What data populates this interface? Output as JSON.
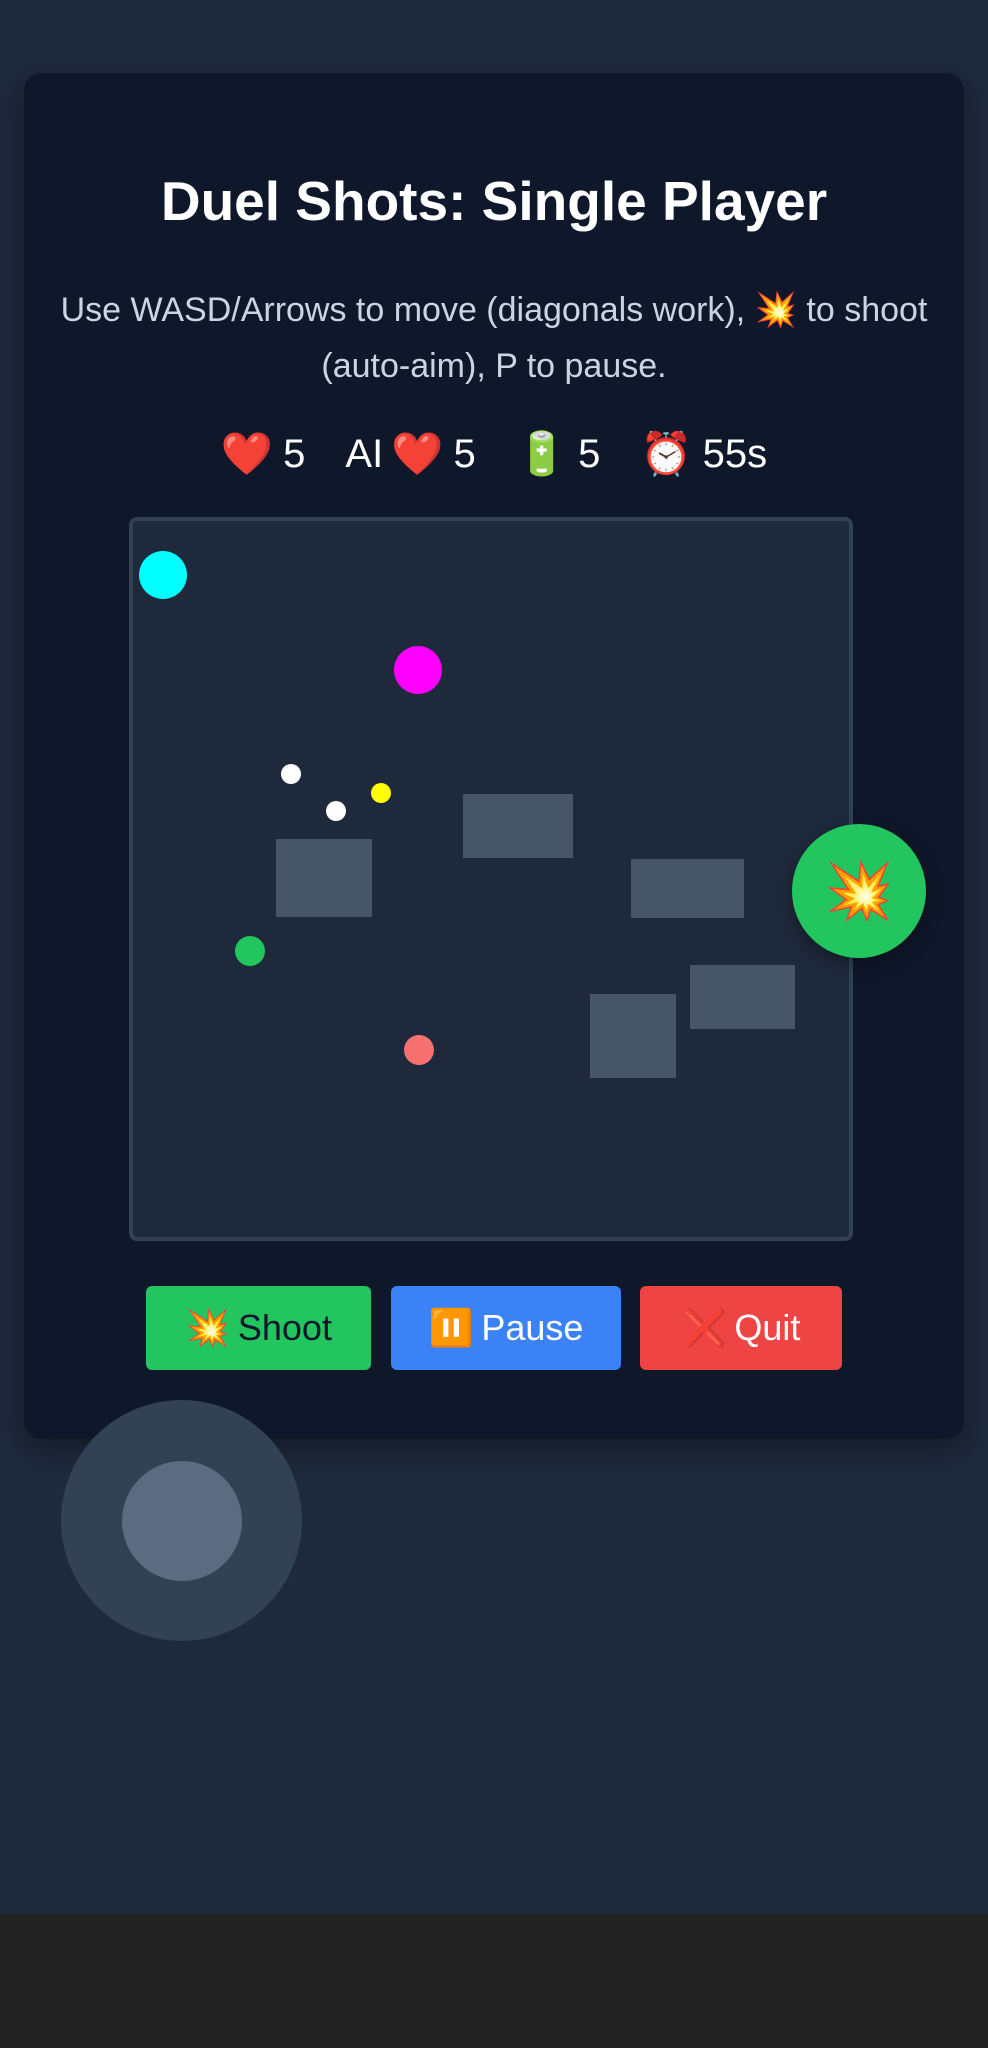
{
  "title": "Duel Shots: Single Player",
  "instructions": "Use WASD/Arrows to move (diagonals work), 💥 to shoot (auto-aim), P to pause.",
  "hud": {
    "player_lives_icon": "❤️",
    "player_lives": "5",
    "ai_label": "AI",
    "ai_lives_icon": "❤️",
    "ai_lives": "5",
    "ammo_icon": "🔋",
    "ammo": "5",
    "timer_icon": "⏰",
    "timer": "55s"
  },
  "fab": {
    "icon": "💥"
  },
  "buttons": {
    "shoot_icon": "💥",
    "shoot_label": "Shoot",
    "pause_icon": "⏸️",
    "pause_label": "Pause",
    "quit_icon": "❌",
    "quit_label": "Quit"
  },
  "colors": {
    "player": "#00ffff",
    "ai": "#ff00ff",
    "bullet": "#ffffff",
    "ai_bullet": "#ffff00",
    "health_pickup": "#22c55e",
    "hazard": "#f87171",
    "wall": "#475569"
  }
}
